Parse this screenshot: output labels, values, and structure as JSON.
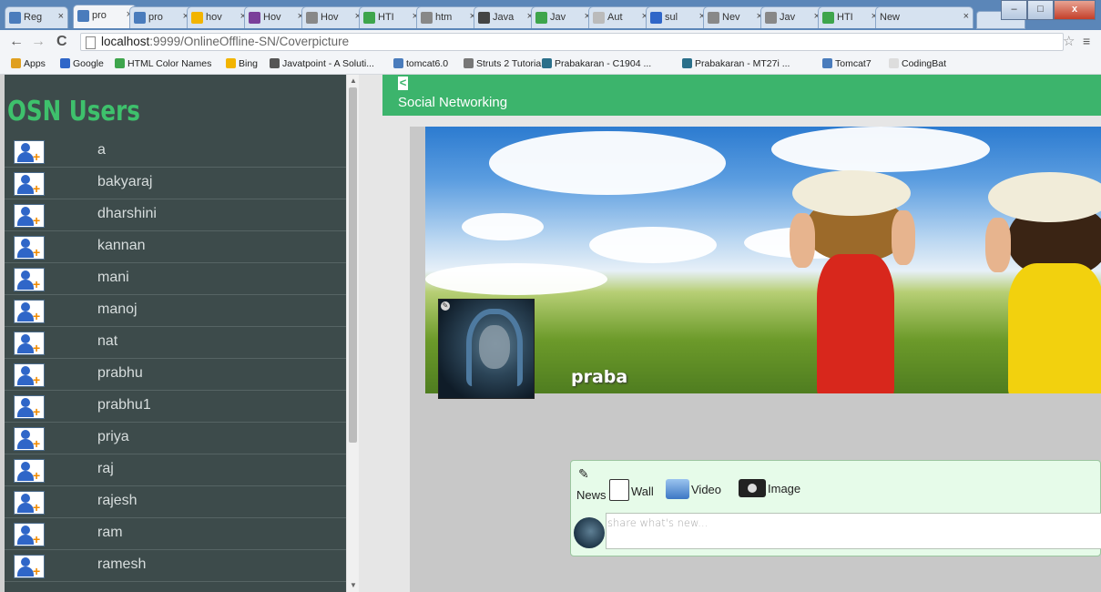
{
  "browser": {
    "tabs": [
      {
        "title": "Reg",
        "color": "#4a7cbc"
      },
      {
        "title": "pro",
        "color": "#4a7cbc",
        "active": true
      },
      {
        "title": "pro",
        "color": "#4a7cbc"
      },
      {
        "title": "hov",
        "color": "#f2b400"
      },
      {
        "title": "Hov",
        "color": "#7a3f9a"
      },
      {
        "title": "Hov",
        "color": "#888888"
      },
      {
        "title": "HTI",
        "color": "#3ea54c"
      },
      {
        "title": "htm",
        "color": "#888888"
      },
      {
        "title": "Java",
        "color": "#444444"
      },
      {
        "title": "Jav",
        "color": "#3ea54c"
      },
      {
        "title": "Aut",
        "color": "#bbbbbb"
      },
      {
        "title": "sul",
        "color": "#2f66c8"
      },
      {
        "title": "Nev",
        "color": "#888888"
      },
      {
        "title": "Jav",
        "color": "#888888"
      },
      {
        "title": "HTI",
        "color": "#3ea54c"
      },
      {
        "title": "New T",
        "color": ""
      }
    ],
    "tab_close": "×",
    "back_icon": "←",
    "forward_icon": "→",
    "reload_icon": "C",
    "url_host": "localhost",
    "url_rest": ":9999/OnlineOffline-SN/Coverpicture",
    "star_icon": "☆",
    "menu_icon": "≡",
    "window_buttons": {
      "minimize": "–",
      "maximize": "□",
      "close": "x"
    }
  },
  "bookmarks": [
    {
      "label": "Apps",
      "color": "#e0a020"
    },
    {
      "label": "Google",
      "color": "#2f66c8"
    },
    {
      "label": "HTML Color Names",
      "color": "#3ea54c"
    },
    {
      "label": "Bing",
      "color": "#f2b400"
    },
    {
      "label": "Javatpoint - A Soluti...",
      "color": "#555555"
    },
    {
      "label": "tomcat6.0",
      "color": "#4a7cbc"
    },
    {
      "label": "Struts 2 Tutorial",
      "color": "#777777"
    },
    {
      "label": "Prabakaran - C1904 ...",
      "color": "#2a6f8a"
    },
    {
      "label": "Prabakaran - MT27i ...",
      "color": "#2a6f8a"
    },
    {
      "label": "Tomcat7",
      "color": "#4a7cbc"
    },
    {
      "label": "CodingBat",
      "color": "#dddddd"
    }
  ],
  "sidebar": {
    "title": "OSN Users",
    "users": [
      "a",
      "bakyaraj",
      "dharshini",
      "kannan",
      "mani",
      "manoj",
      "nat",
      "prabhu",
      "prabhu1",
      "priya",
      "raj",
      "rajesh",
      "ram",
      "ramesh"
    ]
  },
  "header": {
    "back_label": "<",
    "title": "Social Networking"
  },
  "profile": {
    "name": "praba"
  },
  "post": {
    "tabs": [
      "News",
      "Wall",
      "Video",
      "Image"
    ],
    "placeholder": "share what's new..."
  },
  "colors": {
    "accent": "#3cb46c",
    "sidebar_bg": "#3d4b4b",
    "sidebar_title": "#3ec16c"
  }
}
